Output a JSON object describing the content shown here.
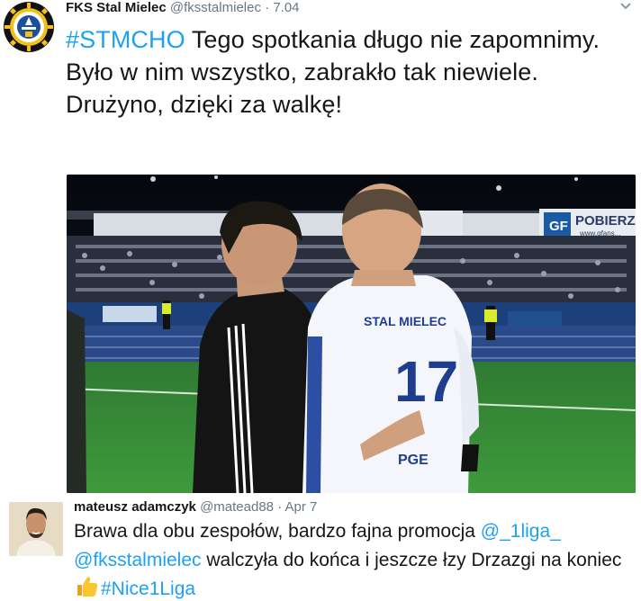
{
  "tweet": {
    "author_name": "FKS Stal Mielec",
    "author_handle": "@fksstalmielec",
    "separator": "·",
    "time": "7.04",
    "hashtag": "#STMCHO",
    "text": " Tego spotkania długo nie zapomnimy. Było w nim wszystko, zabrakło tak niewiele. Drużyno, dzięki za walkę!",
    "photo": {
      "banner_text": "POBIERZ",
      "banner_small": "www.gfans...",
      "jersey_team": "STAL MIELEC",
      "jersey_number": "17",
      "sponsor": "PGE",
      "ad_gf": "GF"
    }
  },
  "reply": {
    "author_name": "mateusz adamczyk",
    "author_handle": "@matead88",
    "separator": "·",
    "time": "Apr 7",
    "text_start": "Brawa dla obu zespołów, bardzo fajna promocja ",
    "mention_1": "@_1liga_",
    "mention_2": "@fksstalmielec",
    "text_middle": " walczyła do końca i jeszcze łzy Drzazgi na koniec",
    "hashtag": "#Nice1Liga"
  },
  "colors": {
    "link": "#1da1f2",
    "text": "#14171a",
    "muted": "#657786"
  },
  "icons": [
    "club-logo-icon",
    "chevron-down-icon",
    "thumbs-up-icon"
  ]
}
